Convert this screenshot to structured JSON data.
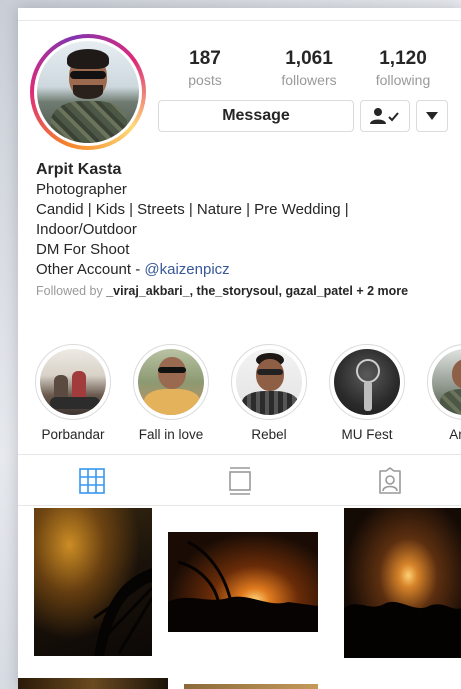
{
  "profile": {
    "name": "Arpit Kasta",
    "stats": [
      {
        "value": "187",
        "label": "posts"
      },
      {
        "value": "1,061",
        "label": "followers"
      },
      {
        "value": "1,120",
        "label": "following"
      }
    ],
    "message_label": "Message",
    "bio_lines": [
      "Photographer",
      "Candid | Kids | Streets | Nature | Pre Wedding | Indoor/Outdoor",
      "DM For Shoot"
    ],
    "other_account_prefix": "Other Account - ",
    "other_account_link": "@kaizenpicz",
    "followed_by_prefix": "Followed by ",
    "followed_by_names": "_viraj_akbari_, the_storysoul, gazal_patel",
    "followed_by_suffix": " + 2 more"
  },
  "highlights": [
    {
      "label": "Porbandar"
    },
    {
      "label": "Fall in love"
    },
    {
      "label": "Rebel"
    },
    {
      "label": "MU Fest"
    },
    {
      "label": "Army"
    }
  ],
  "tabs": [
    {
      "icon": "grid-icon",
      "active": true
    },
    {
      "icon": "feed-icon",
      "active": false
    },
    {
      "icon": "tagged-icon",
      "active": false
    }
  ],
  "colors": {
    "link": "#385898",
    "active_tab": "#3897f0",
    "muted_text": "#999999",
    "ring_start": "#f58529",
    "ring_end": "#8134af"
  }
}
